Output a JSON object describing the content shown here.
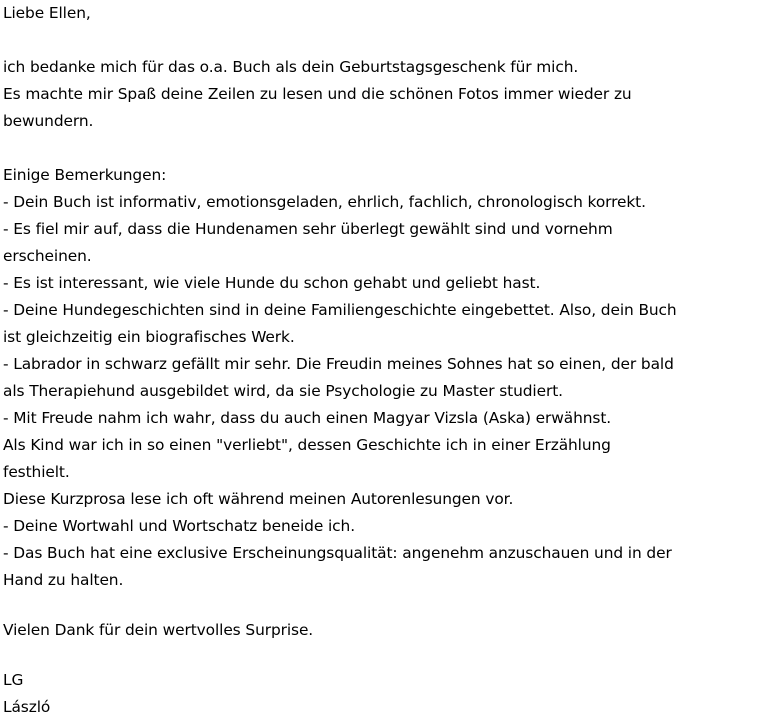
{
  "letter": {
    "salutation": "Liebe Ellen,",
    "thanks": [
      "ich bedanke mich für das o.a. Buch als dein Geburtstagsgeschenk für mich.",
      "Es machte mir Spaß deine Zeilen zu lesen und die schönen Fotos immer wieder zu",
      "bewundern."
    ],
    "remarks_heading": "Einige Bemerkungen:",
    "remarks": [
      "- Dein Buch ist informativ, emotionsgeladen, ehrlich, fachlich, chronologisch korrekt.",
      "- Es fiel mir auf, dass die Hundenamen sehr überlegt gewählt sind und vornehm",
      "erscheinen.",
      "- Es ist interessant, wie viele Hunde du schon gehabt und geliebt hast.",
      "- Deine Hundegeschichten sind in deine Familiengeschichte eingebettet. Also, dein Buch",
      "ist gleichzeitig ein biografisches Werk.",
      "- Labrador in schwarz gefällt mir sehr. Die Freudin meines Sohnes hat so einen, der bald",
      "als Therapiehund ausgebildet wird, da sie Psychologie zu Master studiert.",
      "- Mit Freude nahm ich wahr, dass du auch einen Magyar Vizsla (Aska) erwähnst.",
      "Als Kind war ich in so einen \"verliebt\", dessen Geschichte ich in einer Erzählung",
      "festhielt.",
      "Diese Kurzprosa lese ich oft während meinen Autorenlesungen vor.",
      "- Deine Wortwahl und Wortschatz beneide ich.",
      "- Das Buch hat eine exclusive Erscheinungsqualität: angenehm anzuschauen und in der",
      "Hand zu halten."
    ],
    "closing": "Vielen Dank für dein wertvolles Surprise.",
    "greeting": "LG",
    "signature": "László"
  }
}
